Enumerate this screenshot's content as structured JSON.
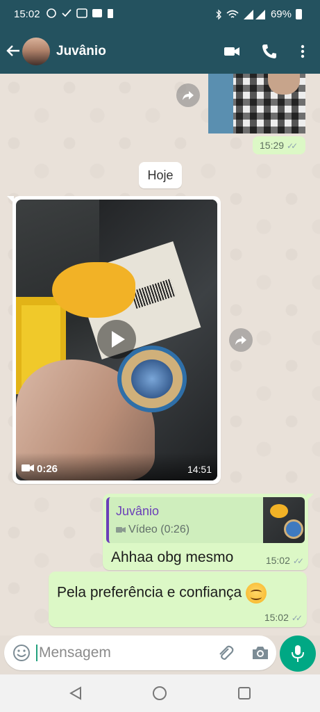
{
  "status_bar": {
    "time": "15:02",
    "battery": "69%",
    "icons": [
      "whatsapp-icon",
      "check-icon",
      "photo-icon",
      "gallery-icon",
      "battery-saver-icon",
      "bluetooth-icon",
      "wifi-icon",
      "signal-icon"
    ]
  },
  "header": {
    "contact_name": "Juvânio",
    "actions": [
      "video-call-icon",
      "voice-call-icon",
      "more-options-icon"
    ]
  },
  "chat": {
    "previous_message": {
      "time": "15:29"
    },
    "date_chip": "Hoje",
    "video_message": {
      "duration": "0:26",
      "time": "14:51"
    },
    "reply_message": {
      "quoted_name": "Juvânio",
      "quoted_sub": "Vídeo (0:26)",
      "text": "Ahhaa obg mesmo",
      "time": "15:02"
    },
    "text_message": {
      "text": "Pela preferência e confiança",
      "time": "15:02"
    }
  },
  "composer": {
    "placeholder": "Mensagem"
  },
  "colors": {
    "header": "#24525f",
    "outgoing_bubble": "#dcf8c6",
    "accent": "#00a884",
    "quote_bar": "#6a3fb8"
  }
}
